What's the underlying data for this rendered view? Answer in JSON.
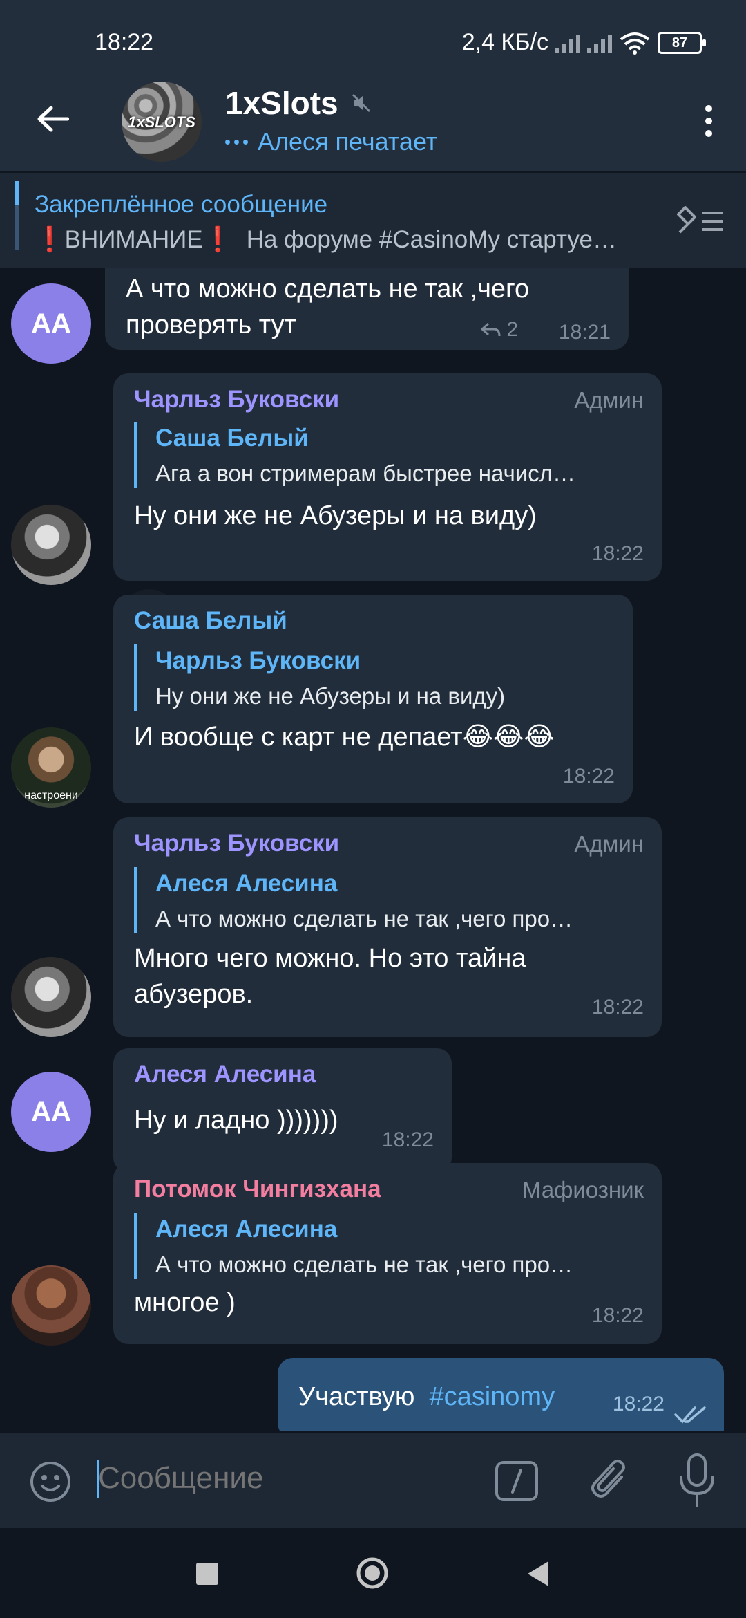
{
  "status_bar": {
    "time": "18:22",
    "network_speed": "2,4 КБ/с",
    "battery": "87"
  },
  "header": {
    "title": "1xSlots",
    "avatar_logo": "1xSLOTS",
    "subtitle": "Алеся печатает",
    "icons": [
      "back-arrow-icon",
      "mute-icon",
      "more-vertical-icon"
    ]
  },
  "pinned": {
    "title": "Закреплённое сообщение",
    "warn_glyph": "❗",
    "text_prefix": "ВНИМАНИЕ",
    "text_body": "На форуме #CasinoMy стартуе…"
  },
  "messages": [
    {
      "avatar": "АА",
      "text_lines": [
        "А что можно сделать не так ,чего",
        "проверять тут"
      ],
      "reply_count": "2",
      "time": "18:21"
    },
    {
      "sender": "Чарльз Буковски",
      "sender_color": "#9e94ff",
      "role": "Админ",
      "reply_name": "Саша Белый",
      "reply_text": "Ага а вон стримерам быстрее начисл…",
      "text": "Ну они же не Абузеры и на виду)",
      "time": "18:22"
    },
    {
      "sender": "Саша Белый",
      "sender_color": "#5eb5f7",
      "reply_name": "Чарльз Буковски",
      "reply_text": "Ну они же не Абузеры и на виду)",
      "text": "И вообще с карт не депает😂😂😂",
      "avatar_caption": "настроени",
      "time": "18:22"
    },
    {
      "sender": "Чарльз Буковски",
      "sender_color": "#9e94ff",
      "role": "Админ",
      "reply_name": "Алеся Алесина",
      "reply_text": "А что можно сделать не так ,чего про…",
      "text_lines": [
        "Много чего можно. Но это тайна",
        "абузеров."
      ],
      "time": "18:22"
    },
    {
      "sender": "Алеся Алесина",
      "sender_color": "#9e94ff",
      "avatar": "АА",
      "text": "Ну и ладно )))))))",
      "time": "18:22"
    },
    {
      "sender": "Потомок Чингизхана",
      "sender_color": "#f47ea0",
      "role": "Мафиозник",
      "reply_name": "Алеся Алесина",
      "reply_text": "А что можно сделать не так ,чего про…",
      "text": "многое )",
      "time": "18:22"
    },
    {
      "outgoing": true,
      "text": "Участвую",
      "hashtag": "#casinomy",
      "time": "18:22"
    }
  ],
  "composer": {
    "placeholder": "Сообщение"
  },
  "colors": {
    "header_bg": "#232e3c",
    "accent": "#5eb5f7",
    "bubble_in": "#212d3b",
    "bubble_out": "#2b5278",
    "avatar_aa": "#8b7fe8"
  }
}
